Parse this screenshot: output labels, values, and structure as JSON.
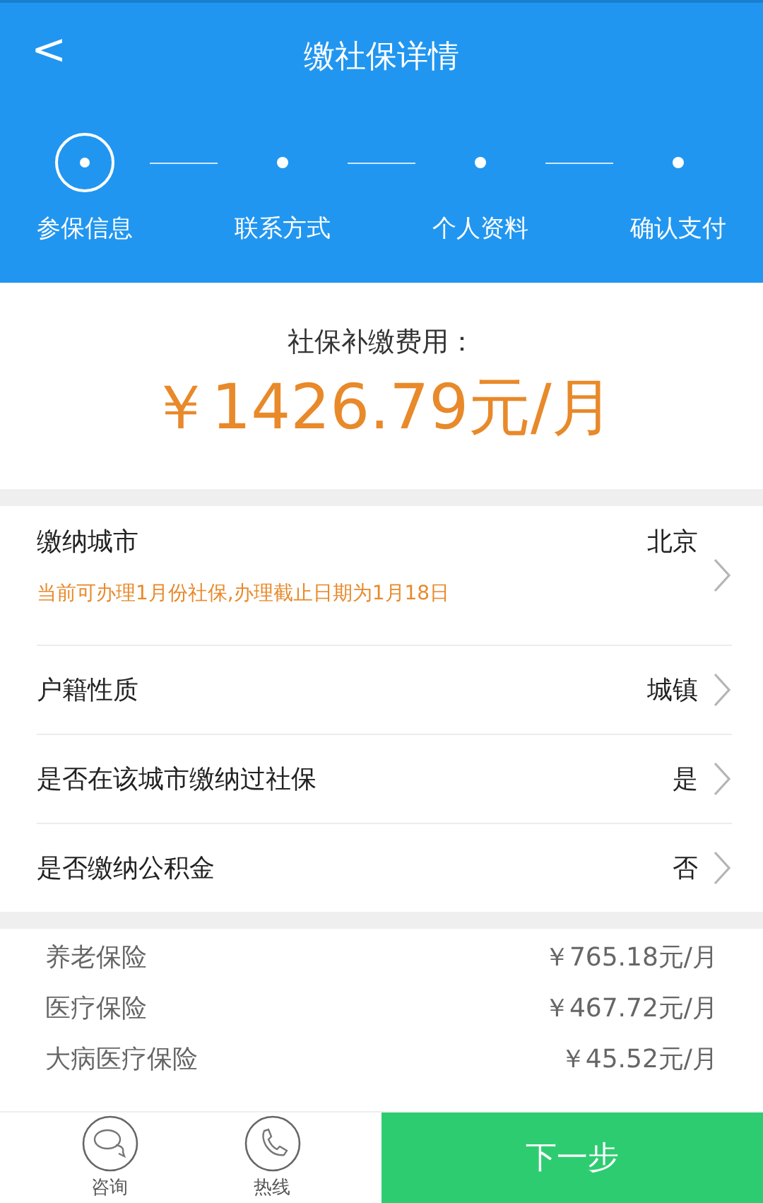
{
  "header": {
    "back": "<",
    "title": "缴社保详情"
  },
  "steps": [
    {
      "label": "参保信息",
      "selected": true
    },
    {
      "label": "联系方式",
      "selected": false
    },
    {
      "label": "个人资料",
      "selected": false
    },
    {
      "label": "确认支付",
      "selected": false
    }
  ],
  "summary": {
    "label": "社保补缴费用：",
    "amount": "￥1426.79元/月"
  },
  "settings": [
    {
      "label": "缴纳城市",
      "value": "北京",
      "note": "当前可办理1月份社保,办理截止日期为1月18日"
    },
    {
      "label": "户籍性质",
      "value": "城镇"
    },
    {
      "label": "是否在该城市缴纳过社保",
      "value": "是"
    },
    {
      "label": "是否缴纳公积金",
      "value": "否"
    }
  ],
  "breakdown": [
    {
      "name": "养老保险",
      "amount": "￥765.18元/月"
    },
    {
      "name": "医疗保险",
      "amount": "￥467.72元/月"
    },
    {
      "name": "大病医疗保险",
      "amount": "￥45.52元/月"
    }
  ],
  "bottom_bar": {
    "actions": [
      {
        "kind": "chat",
        "label": "咨询"
      },
      {
        "kind": "phone",
        "label": "热线"
      }
    ],
    "next": "下一步"
  }
}
